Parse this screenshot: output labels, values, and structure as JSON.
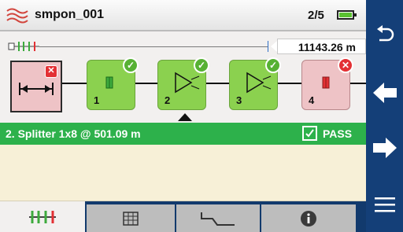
{
  "header": {
    "file_name": "smpon_001",
    "page_counter": "2/5",
    "logo_icon": "signal-waves-icon",
    "battery_icon": "battery-icon"
  },
  "overview": {
    "distance": "11143.26 m"
  },
  "events": [
    {
      "number": "1",
      "type": "connector-icon",
      "status": "pass"
    },
    {
      "number": "2",
      "type": "splitter-icon",
      "status": "pass",
      "selected": true
    },
    {
      "number": "3",
      "type": "splitter-icon",
      "status": "pass"
    },
    {
      "number": "4",
      "type": "connector-icon",
      "status": "fail"
    }
  ],
  "status_bar": {
    "event_title": "2. Splitter 1x8 @ 501.09 m",
    "pass_label": "PASS"
  },
  "tabs": [
    {
      "name": "link-view",
      "icon": "link-view-icon",
      "active": true
    },
    {
      "name": "table",
      "icon": "table-icon",
      "active": false
    },
    {
      "name": "trace",
      "icon": "trace-icon",
      "active": false
    },
    {
      "name": "info",
      "icon": "info-icon",
      "active": false
    }
  ],
  "side_nav": [
    {
      "icon": "back-arrow-icon"
    },
    {
      "icon": "arrow-left-icon"
    },
    {
      "icon": "arrow-right-icon"
    },
    {
      "icon": "menu-icon"
    }
  ],
  "colors": {
    "nav_blue": "#143f78",
    "pass_green": "#2db14b",
    "event_green": "#8bd14f",
    "fail_red": "#e33034",
    "fail_pink": "#eec3c6",
    "detail_yellow": "#f7f0d7"
  }
}
